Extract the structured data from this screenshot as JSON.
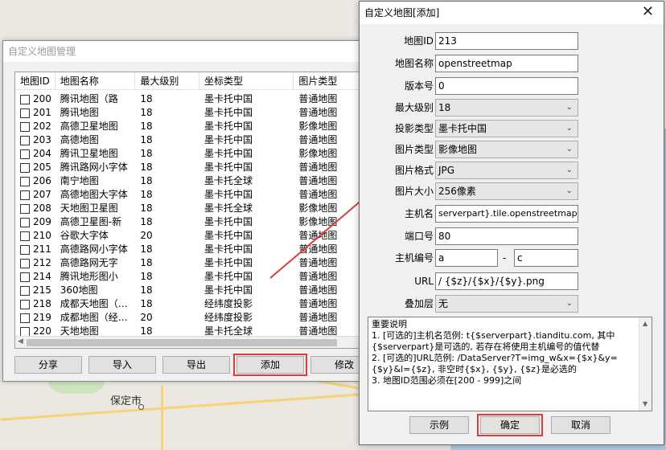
{
  "map": {
    "city": "保定市"
  },
  "manager": {
    "title": "自定义地图管理",
    "columns": [
      "地图ID",
      "地图名称",
      "最大级别",
      "坐标类型",
      "图片类型"
    ],
    "rows": [
      {
        "id": "200",
        "name": "腾讯地图（路",
        "level": "18",
        "coord": "墨卡托中国",
        "imgtype": "普通地图"
      },
      {
        "id": "201",
        "name": "腾讯地图",
        "level": "18",
        "coord": "墨卡托中国",
        "imgtype": "普通地图"
      },
      {
        "id": "202",
        "name": "高德卫星地图",
        "level": "18",
        "coord": "墨卡托中国",
        "imgtype": "影像地图"
      },
      {
        "id": "203",
        "name": "高德地图",
        "level": "18",
        "coord": "墨卡托中国",
        "imgtype": "普通地图"
      },
      {
        "id": "204",
        "name": "腾讯卫星地图",
        "level": "18",
        "coord": "墨卡托中国",
        "imgtype": "影像地图"
      },
      {
        "id": "205",
        "name": "腾讯路网小字体",
        "level": "18",
        "coord": "墨卡托中国",
        "imgtype": "普通地图"
      },
      {
        "id": "206",
        "name": "南宁地图",
        "level": "18",
        "coord": "墨卡托全球",
        "imgtype": "普通地图"
      },
      {
        "id": "207",
        "name": "高德地图大字体",
        "level": "18",
        "coord": "墨卡托中国",
        "imgtype": "普通地图"
      },
      {
        "id": "208",
        "name": "天地图卫星图",
        "level": "18",
        "coord": "墨卡托全球",
        "imgtype": "影像地图"
      },
      {
        "id": "209",
        "name": "高德卫星图-新",
        "level": "18",
        "coord": "墨卡托中国",
        "imgtype": "影像地图"
      },
      {
        "id": "210",
        "name": "谷歌大字体",
        "level": "20",
        "coord": "墨卡托中国",
        "imgtype": "普通地图"
      },
      {
        "id": "211",
        "name": "高德路网小字体",
        "level": "18",
        "coord": "墨卡托中国",
        "imgtype": "普通地图"
      },
      {
        "id": "212",
        "name": "高德路网无字",
        "level": "18",
        "coord": "墨卡托中国",
        "imgtype": "普通地图"
      },
      {
        "id": "214",
        "name": "腾讯地形图小",
        "level": "18",
        "coord": "墨卡托中国",
        "imgtype": "普通地图"
      },
      {
        "id": "215",
        "name": "360地图",
        "level": "18",
        "coord": "墨卡托中国",
        "imgtype": "普通地图"
      },
      {
        "id": "218",
        "name": "成都天地图（…",
        "level": "18",
        "coord": "经纬度投影",
        "imgtype": "普通地图"
      },
      {
        "id": "219",
        "name": "成都地图（经…",
        "level": "20",
        "coord": "经纬度投影",
        "imgtype": "普通地图"
      },
      {
        "id": "220",
        "name": "天地地图",
        "level": "18",
        "coord": "墨卡托全球",
        "imgtype": "普通地图"
      }
    ],
    "buttons": {
      "share": "分享",
      "import": "导入",
      "export": "导出",
      "add": "添加",
      "edit": "修改"
    }
  },
  "dialog": {
    "title": "自定义地图[添加]",
    "close": "✕",
    "fields": {
      "map_id": {
        "label": "地图ID",
        "value": "213"
      },
      "map_name": {
        "label": "地图名称",
        "value": "openstreetmap"
      },
      "version": {
        "label": "版本号",
        "value": "0"
      },
      "max_level": {
        "label": "最大级别",
        "value": "18"
      },
      "projection": {
        "label": "投影类型",
        "value": "墨卡托中国"
      },
      "image_type": {
        "label": "图片类型",
        "value": "影像地图"
      },
      "image_format": {
        "label": "图片格式",
        "value": "JPG"
      },
      "image_size": {
        "label": "图片大小",
        "value": "256像素"
      },
      "host": {
        "label": "主机名",
        "value": "serverpart}.tile.openstreetmap.org"
      },
      "port": {
        "label": "端口号",
        "value": "80"
      },
      "host_index": {
        "label": "主机编号",
        "from": "a",
        "sep": "-",
        "to": "c"
      },
      "url": {
        "label": "URL",
        "value": "/ {$z}/{$x}/{$y}.png"
      },
      "overlay": {
        "label": "叠加层",
        "value": "无"
      }
    },
    "notes": [
      "重要说明",
      "1. [可选的]主机名范例: t{$serverpart}.tianditu.com, 其中{$serverpart}是可选的, 若存在将使用主机编号的值代替",
      "2. [可选的]URL范例: /DataServer?T=img_w&x={$x}&y={$y}&l={$z}, 非空时{$x}, {$y}, {$z}是必选的",
      "3. 地图ID范围必须在[200 - 999]之间"
    ],
    "buttons": {
      "example": "示例",
      "ok": "确定",
      "cancel": "取消"
    }
  },
  "colors": {
    "highlight": "#e03c3c"
  }
}
